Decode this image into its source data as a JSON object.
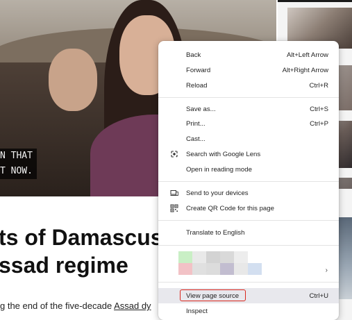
{
  "article": {
    "caption_line1": "N THAT",
    "caption_line2": "T NOW.",
    "headline_line1": "ts of Damascus",
    "headline_line2": "ssad regime",
    "subtext_prefix": "g the end of the five-decade ",
    "subtext_link": "Assad dy"
  },
  "context_menu": {
    "back": {
      "label": "Back",
      "shortcut": "Alt+Left Arrow"
    },
    "forward": {
      "label": "Forward",
      "shortcut": "Alt+Right Arrow"
    },
    "reload": {
      "label": "Reload",
      "shortcut": "Ctrl+R"
    },
    "save_as": {
      "label": "Save as...",
      "shortcut": "Ctrl+S"
    },
    "print": {
      "label": "Print...",
      "shortcut": "Ctrl+P"
    },
    "cast": {
      "label": "Cast..."
    },
    "search_lens": {
      "label": "Search with Google Lens",
      "icon": "lens-icon"
    },
    "reading_mode": {
      "label": "Open in reading mode"
    },
    "send_devices": {
      "label": "Send to your devices",
      "icon": "devices-icon"
    },
    "qr_code": {
      "label": "Create QR Code for this page",
      "icon": "qr-code-icon"
    },
    "translate": {
      "label": "Translate to English"
    },
    "extension_chevron": "›",
    "view_source": {
      "label": "View page source",
      "shortcut": "Ctrl+U"
    },
    "inspect": {
      "label": "Inspect"
    }
  },
  "colors": {
    "highlight": "#e8e8ed",
    "focus_ring": "#d9261c",
    "menu_bg": "#ffffff"
  }
}
